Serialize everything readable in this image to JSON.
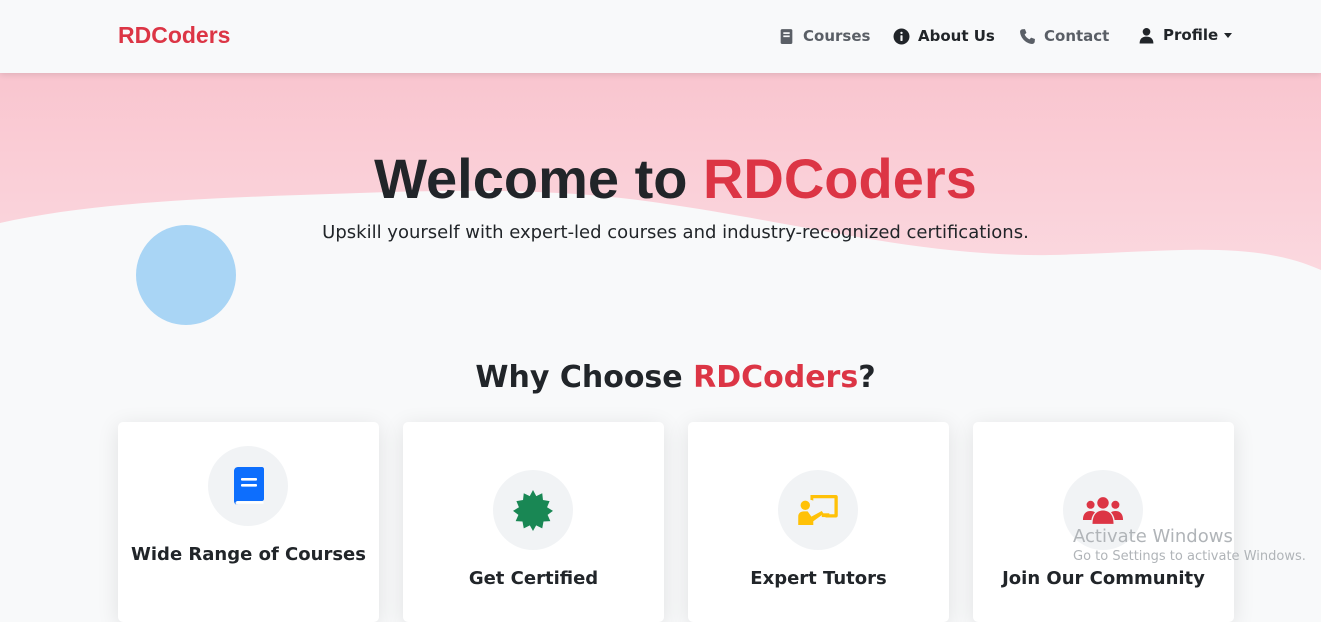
{
  "navbar": {
    "brand": "RDCoders",
    "items": [
      {
        "label": "Courses",
        "icon": "book-icon"
      },
      {
        "label": "About Us",
        "icon": "info-circle-icon"
      },
      {
        "label": "Contact",
        "icon": "phone-icon"
      },
      {
        "label": "Profile",
        "icon": "user-icon"
      }
    ]
  },
  "hero": {
    "title_prefix": "Welcome to ",
    "title_brand": "RDCoders",
    "subtitle": "Upskill yourself with expert-led courses and industry-recognized certifications."
  },
  "why": {
    "title_prefix": "Why Choose ",
    "title_brand": "RDCoders",
    "title_suffix": "?",
    "cards": [
      {
        "title": "Wide Range of Courses",
        "icon": "book-icon",
        "icon_color": "#0d6efd"
      },
      {
        "title": "Get Certified",
        "icon": "certificate-icon",
        "icon_color": "#198754"
      },
      {
        "title": "Expert Tutors",
        "icon": "chalkboard-teacher-icon",
        "icon_color": "#ffc107"
      },
      {
        "title": "Join Our Community",
        "icon": "users-icon",
        "icon_color": "#dc3545"
      }
    ]
  },
  "watermark": {
    "title": "Activate Windows",
    "subtitle": "Go to Settings to activate Windows."
  },
  "colors": {
    "accent": "#dc3545",
    "hero_pink": "#f8d7dd",
    "blob_blue": "#a9d5f5"
  }
}
